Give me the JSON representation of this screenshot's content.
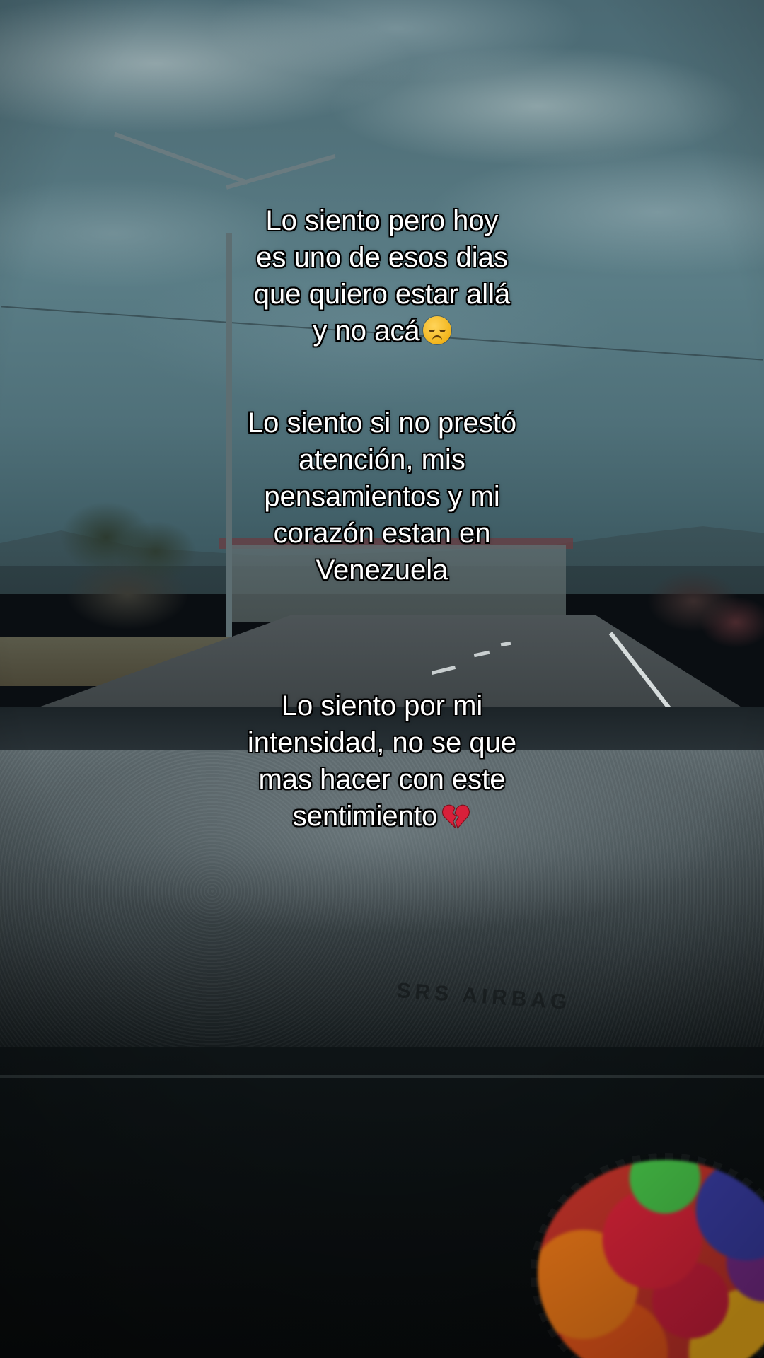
{
  "caption": {
    "block1": [
      "Lo siento pero hoy",
      "es uno de esos dias",
      "que quiero estar allá",
      "y no acá"
    ],
    "block2": [
      "Lo siento si no prestó",
      "atención, mis",
      "pensamientos y mi",
      "corazón estan en",
      "Venezuela"
    ],
    "block3": [
      "Lo siento por mi",
      "intensidad, no se que",
      "mas hacer con este",
      "sentimiento"
    ]
  },
  "icons": {
    "pensive": "pensive-face-emoji",
    "heart": "broken-heart-emoji"
  },
  "dashboard_label": "SRS AIRBAG",
  "colors": {
    "text": "#ffffff",
    "text_outline": "#000000",
    "heart": "#d8203a",
    "sky": "#52727b"
  }
}
